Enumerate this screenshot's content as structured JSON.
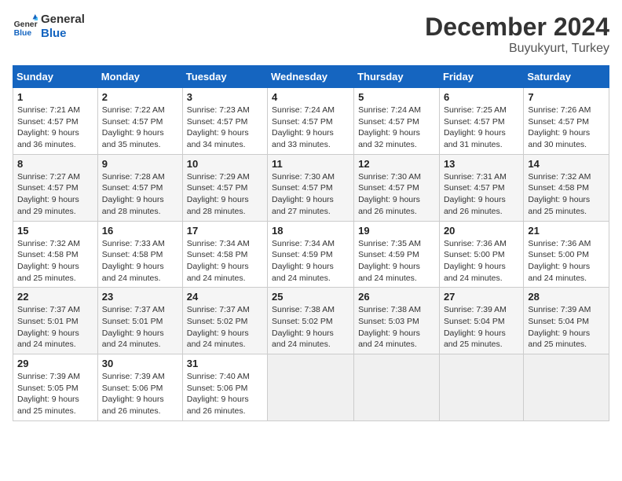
{
  "logo": {
    "line1": "General",
    "line2": "Blue"
  },
  "title": "December 2024",
  "subtitle": "Buyukyurt, Turkey",
  "days_of_week": [
    "Sunday",
    "Monday",
    "Tuesday",
    "Wednesday",
    "Thursday",
    "Friday",
    "Saturday"
  ],
  "weeks": [
    [
      {
        "day": "1",
        "info": "Sunrise: 7:21 AM\nSunset: 4:57 PM\nDaylight: 9 hours\nand 36 minutes."
      },
      {
        "day": "2",
        "info": "Sunrise: 7:22 AM\nSunset: 4:57 PM\nDaylight: 9 hours\nand 35 minutes."
      },
      {
        "day": "3",
        "info": "Sunrise: 7:23 AM\nSunset: 4:57 PM\nDaylight: 9 hours\nand 34 minutes."
      },
      {
        "day": "4",
        "info": "Sunrise: 7:24 AM\nSunset: 4:57 PM\nDaylight: 9 hours\nand 33 minutes."
      },
      {
        "day": "5",
        "info": "Sunrise: 7:24 AM\nSunset: 4:57 PM\nDaylight: 9 hours\nand 32 minutes."
      },
      {
        "day": "6",
        "info": "Sunrise: 7:25 AM\nSunset: 4:57 PM\nDaylight: 9 hours\nand 31 minutes."
      },
      {
        "day": "7",
        "info": "Sunrise: 7:26 AM\nSunset: 4:57 PM\nDaylight: 9 hours\nand 30 minutes."
      }
    ],
    [
      {
        "day": "8",
        "info": "Sunrise: 7:27 AM\nSunset: 4:57 PM\nDaylight: 9 hours\nand 29 minutes."
      },
      {
        "day": "9",
        "info": "Sunrise: 7:28 AM\nSunset: 4:57 PM\nDaylight: 9 hours\nand 28 minutes."
      },
      {
        "day": "10",
        "info": "Sunrise: 7:29 AM\nSunset: 4:57 PM\nDaylight: 9 hours\nand 28 minutes."
      },
      {
        "day": "11",
        "info": "Sunrise: 7:30 AM\nSunset: 4:57 PM\nDaylight: 9 hours\nand 27 minutes."
      },
      {
        "day": "12",
        "info": "Sunrise: 7:30 AM\nSunset: 4:57 PM\nDaylight: 9 hours\nand 26 minutes."
      },
      {
        "day": "13",
        "info": "Sunrise: 7:31 AM\nSunset: 4:57 PM\nDaylight: 9 hours\nand 26 minutes."
      },
      {
        "day": "14",
        "info": "Sunrise: 7:32 AM\nSunset: 4:58 PM\nDaylight: 9 hours\nand 25 minutes."
      }
    ],
    [
      {
        "day": "15",
        "info": "Sunrise: 7:32 AM\nSunset: 4:58 PM\nDaylight: 9 hours\nand 25 minutes."
      },
      {
        "day": "16",
        "info": "Sunrise: 7:33 AM\nSunset: 4:58 PM\nDaylight: 9 hours\nand 24 minutes."
      },
      {
        "day": "17",
        "info": "Sunrise: 7:34 AM\nSunset: 4:58 PM\nDaylight: 9 hours\nand 24 minutes."
      },
      {
        "day": "18",
        "info": "Sunrise: 7:34 AM\nSunset: 4:59 PM\nDaylight: 9 hours\nand 24 minutes."
      },
      {
        "day": "19",
        "info": "Sunrise: 7:35 AM\nSunset: 4:59 PM\nDaylight: 9 hours\nand 24 minutes."
      },
      {
        "day": "20",
        "info": "Sunrise: 7:36 AM\nSunset: 5:00 PM\nDaylight: 9 hours\nand 24 minutes."
      },
      {
        "day": "21",
        "info": "Sunrise: 7:36 AM\nSunset: 5:00 PM\nDaylight: 9 hours\nand 24 minutes."
      }
    ],
    [
      {
        "day": "22",
        "info": "Sunrise: 7:37 AM\nSunset: 5:01 PM\nDaylight: 9 hours\nand 24 minutes."
      },
      {
        "day": "23",
        "info": "Sunrise: 7:37 AM\nSunset: 5:01 PM\nDaylight: 9 hours\nand 24 minutes."
      },
      {
        "day": "24",
        "info": "Sunrise: 7:37 AM\nSunset: 5:02 PM\nDaylight: 9 hours\nand 24 minutes."
      },
      {
        "day": "25",
        "info": "Sunrise: 7:38 AM\nSunset: 5:02 PM\nDaylight: 9 hours\nand 24 minutes."
      },
      {
        "day": "26",
        "info": "Sunrise: 7:38 AM\nSunset: 5:03 PM\nDaylight: 9 hours\nand 24 minutes."
      },
      {
        "day": "27",
        "info": "Sunrise: 7:39 AM\nSunset: 5:04 PM\nDaylight: 9 hours\nand 25 minutes."
      },
      {
        "day": "28",
        "info": "Sunrise: 7:39 AM\nSunset: 5:04 PM\nDaylight: 9 hours\nand 25 minutes."
      }
    ],
    [
      {
        "day": "29",
        "info": "Sunrise: 7:39 AM\nSunset: 5:05 PM\nDaylight: 9 hours\nand 25 minutes."
      },
      {
        "day": "30",
        "info": "Sunrise: 7:39 AM\nSunset: 5:06 PM\nDaylight: 9 hours\nand 26 minutes."
      },
      {
        "day": "31",
        "info": "Sunrise: 7:40 AM\nSunset: 5:06 PM\nDaylight: 9 hours\nand 26 minutes."
      },
      null,
      null,
      null,
      null
    ]
  ]
}
